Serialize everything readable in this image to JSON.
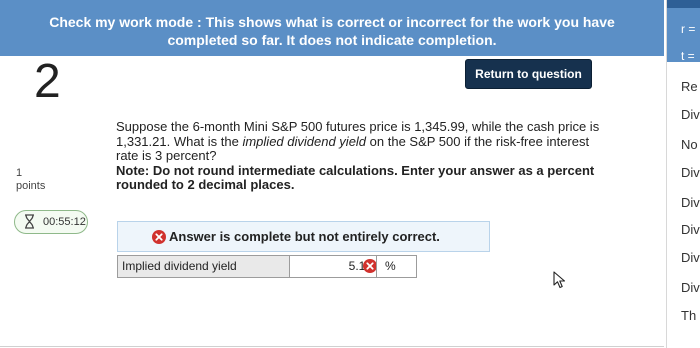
{
  "banner": {
    "line1": "Check my work mode : This shows what is correct or incorrect for the work you have",
    "line2": "completed so far. It does not indicate completion."
  },
  "question_number": "2",
  "points": {
    "value": "1",
    "label": "points"
  },
  "timer": {
    "time": "00:55:12",
    "icon": "hourglass-icon"
  },
  "return_button": {
    "label": "Return to question"
  },
  "question": {
    "part1": "Suppose the 6-month Mini S&P 500 futures price is 1,345.99, while the cash price is 1,331.21. What is the ",
    "emphasis": "implied dividend yield",
    "part2": " on the S&P 500 if the risk-free interest rate is 3 percent?",
    "note": "Note: Do not round intermediate calculations. Enter your answer as a percent rounded to 2 decimal places."
  },
  "result": {
    "text": "Answer is complete but not entirely correct.",
    "icon": "incorrect-x-icon",
    "status_color": "#d0312d"
  },
  "answer": {
    "label": "Implied dividend yield",
    "value": "5.19",
    "unit": "%",
    "status": "incorrect"
  },
  "right_panel": {
    "header_items": [
      "r =",
      "t ="
    ],
    "items": [
      "Re",
      "Div",
      "No",
      "Div",
      "Div",
      "Div",
      "Div",
      "Div",
      "Th"
    ]
  },
  "colors": {
    "banner": "#5b8fc6",
    "button": "#16314e",
    "incorrect": "#d0312d",
    "result_bg": "#eef5fb"
  }
}
